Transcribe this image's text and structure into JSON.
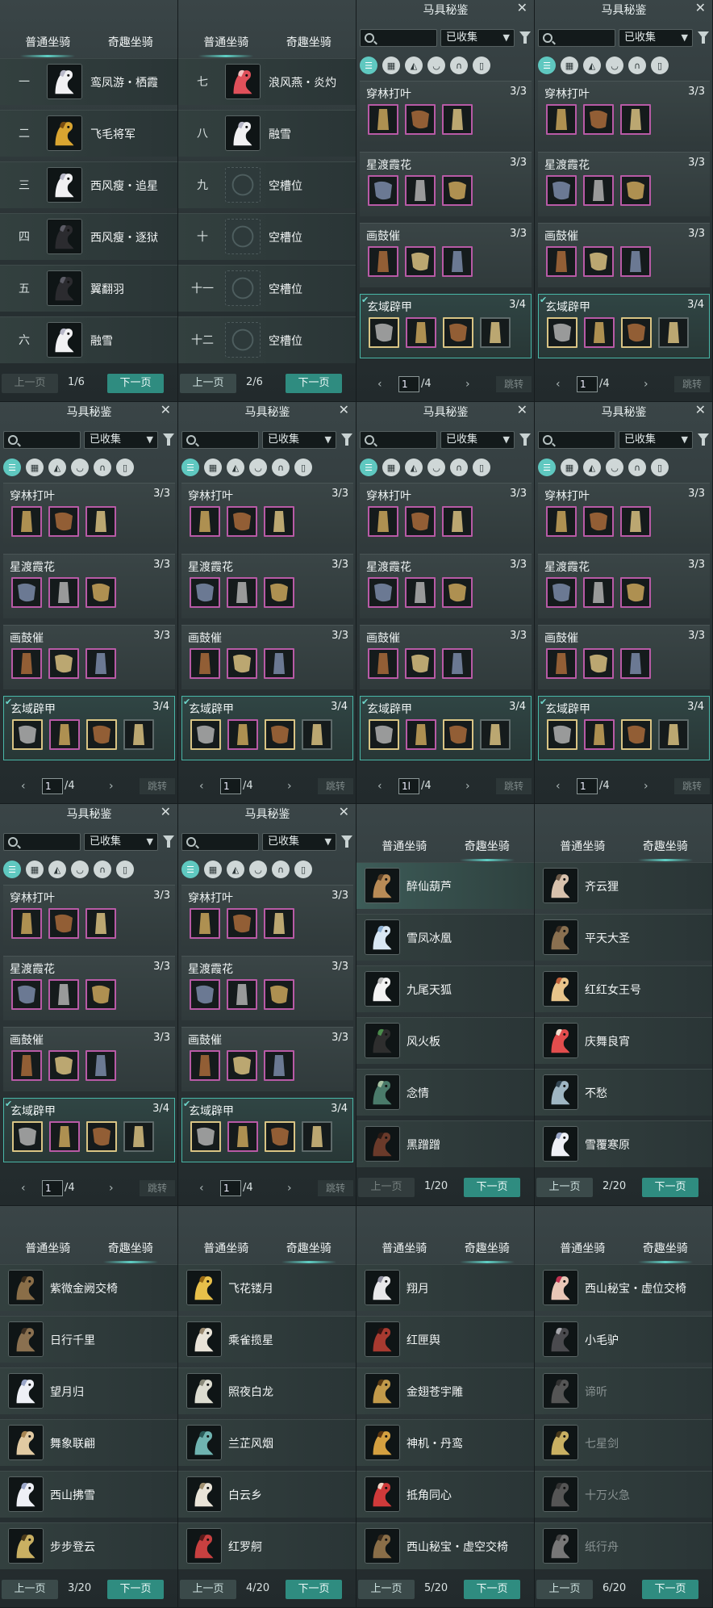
{
  "colors": {
    "accent": "#2f8c80",
    "set_border": "#49b7a8",
    "slot_purple": "#b85aa6",
    "slot_gold": "#d9c484"
  },
  "tabs": {
    "regular": "普通坐骑",
    "fun": "奇趣坐骑"
  },
  "pager_labels": {
    "prev": "上一页",
    "next": "下一页",
    "jump": "跳转"
  },
  "roster_pages": [
    {
      "info": "1/6",
      "prev_disabled": true,
      "rows": [
        {
          "num": "一",
          "name": "鸾凤游・栖霞",
          "icon": "white-horse-icon"
        },
        {
          "num": "二",
          "name": "飞毛将军",
          "icon": "golden-horse-icon"
        },
        {
          "num": "三",
          "name": "西风瘦・追星",
          "icon": "white-horse-icon"
        },
        {
          "num": "四",
          "name": "西风瘦・逐狱",
          "icon": "black-horse-icon"
        },
        {
          "num": "五",
          "name": "翼翻羽",
          "icon": "black-horse-icon"
        },
        {
          "num": "六",
          "name": "融雪",
          "icon": "white-horse-icon"
        }
      ]
    },
    {
      "info": "2/6",
      "prev_disabled": false,
      "rows": [
        {
          "num": "七",
          "name": "浪风燕・炎灼",
          "icon": "red-horse-icon"
        },
        {
          "num": "八",
          "name": "融雪",
          "icon": "white-horse-icon"
        },
        {
          "num": "九",
          "name": "空槽位",
          "icon": "empty-slot-icon"
        },
        {
          "num": "十",
          "name": "空槽位",
          "icon": "empty-slot-icon"
        },
        {
          "num": "十一",
          "name": "空槽位",
          "icon": "empty-slot-icon"
        },
        {
          "num": "十二",
          "name": "空槽位",
          "icon": "empty-slot-icon"
        }
      ]
    }
  ],
  "codex": {
    "title": "马具秘鉴",
    "search_placeholder": "",
    "filter_value": "已收集",
    "categories": [
      "list-icon",
      "grid-icon",
      "saddle-icon",
      "armor-icon",
      "horseshoe-icon",
      "stirrup-icon"
    ],
    "sets": [
      {
        "name": "穿林打叶",
        "count": "3/3",
        "complete": false,
        "slots": [
          "purple",
          "purple",
          "purple"
        ]
      },
      {
        "name": "星渡霞花",
        "count": "3/3",
        "complete": false,
        "slots": [
          "purple",
          "purple",
          "purple"
        ]
      },
      {
        "name": "画鼓催",
        "count": "3/3",
        "complete": false,
        "slots": [
          "purple",
          "purple",
          "purple"
        ]
      },
      {
        "name": "玄域辟甲",
        "count": "3/4",
        "complete": true,
        "slots": [
          "gold",
          "purple",
          "gold",
          "gray"
        ]
      }
    ],
    "page_values": [
      "1",
      "1",
      "1",
      "1",
      "1",
      "1",
      "1l",
      "1",
      "1",
      "1"
    ],
    "page_total": "/4"
  },
  "fun_pages": [
    {
      "info": "1/20",
      "prev_disabled": true,
      "rows": [
        {
          "name": "醉仙葫芦",
          "icon": "gourd-icon",
          "highlight": true
        },
        {
          "name": "雪凤冰凰",
          "icon": "phoenix-icon"
        },
        {
          "name": "九尾天狐",
          "icon": "fox-icon"
        },
        {
          "name": "风火板",
          "icon": "skateboard-icon"
        },
        {
          "name": "念情",
          "icon": "scroll-icon"
        },
        {
          "name": "黑蹭蹭",
          "icon": "boar-icon"
        }
      ]
    },
    {
      "info": "2/20",
      "prev_disabled": false,
      "rows": [
        {
          "name": "齐云狸",
          "icon": "cat-icon"
        },
        {
          "name": "平天大圣",
          "icon": "monkey-icon"
        },
        {
          "name": "红红女王号",
          "icon": "parrot-icon"
        },
        {
          "name": "庆舞良宵",
          "icon": "lion-dance-icon"
        },
        {
          "name": "不愁",
          "icon": "bird-icon"
        },
        {
          "name": "雪覆寒原",
          "icon": "deer-icon"
        }
      ]
    },
    {
      "info": "3/20",
      "prev_disabled": false,
      "rows": [
        {
          "name": "紫微金阙交椅",
          "icon": "chair-icon"
        },
        {
          "name": "日行千里",
          "icon": "monkey-icon"
        },
        {
          "name": "望月归",
          "icon": "deer-icon"
        },
        {
          "name": "舞象联翩",
          "icon": "elephant-icon"
        },
        {
          "name": "西山拂雪",
          "icon": "deer-icon"
        },
        {
          "name": "步步登云",
          "icon": "sword-icon"
        }
      ]
    },
    {
      "info": "4/20",
      "prev_disabled": false,
      "rows": [
        {
          "name": "飞花镂月",
          "icon": "moon-icon"
        },
        {
          "name": "乘雀揽星",
          "icon": "peacock-icon"
        },
        {
          "name": "照夜白龙",
          "icon": "dragon-icon"
        },
        {
          "name": "兰芷风烟",
          "icon": "lantern-icon"
        },
        {
          "name": "白云乡",
          "icon": "crane-icon"
        },
        {
          "name": "红罗舸",
          "icon": "boat-icon"
        }
      ]
    },
    {
      "info": "5/20",
      "prev_disabled": false,
      "rows": [
        {
          "name": "翔月",
          "icon": "owl-icon"
        },
        {
          "name": "红匣舆",
          "icon": "palanquin-icon"
        },
        {
          "name": "金翅苍宇雕",
          "icon": "eagle-icon"
        },
        {
          "name": "神机・丹鸾",
          "icon": "mech-bird-icon"
        },
        {
          "name": "抵角同心",
          "icon": "ox-icon"
        },
        {
          "name": "西山秘宝・虚空交椅",
          "icon": "chair-icon"
        }
      ]
    },
    {
      "info": "6/20",
      "prev_disabled": false,
      "rows": [
        {
          "name": "西山秘宝・虚位交椅",
          "icon": "lady-icon",
          "dim": false
        },
        {
          "name": "小毛驴",
          "icon": "donkey-icon",
          "dim": false
        },
        {
          "name": "谛听",
          "icon": "beast-icon",
          "dim": true
        },
        {
          "name": "七星剑",
          "icon": "sword-icon",
          "dim": true
        },
        {
          "name": "十万火急",
          "icon": "wheel-icon",
          "dim": true
        },
        {
          "name": "纸行舟",
          "icon": "paper-boat-icon",
          "dim": true
        }
      ]
    }
  ]
}
